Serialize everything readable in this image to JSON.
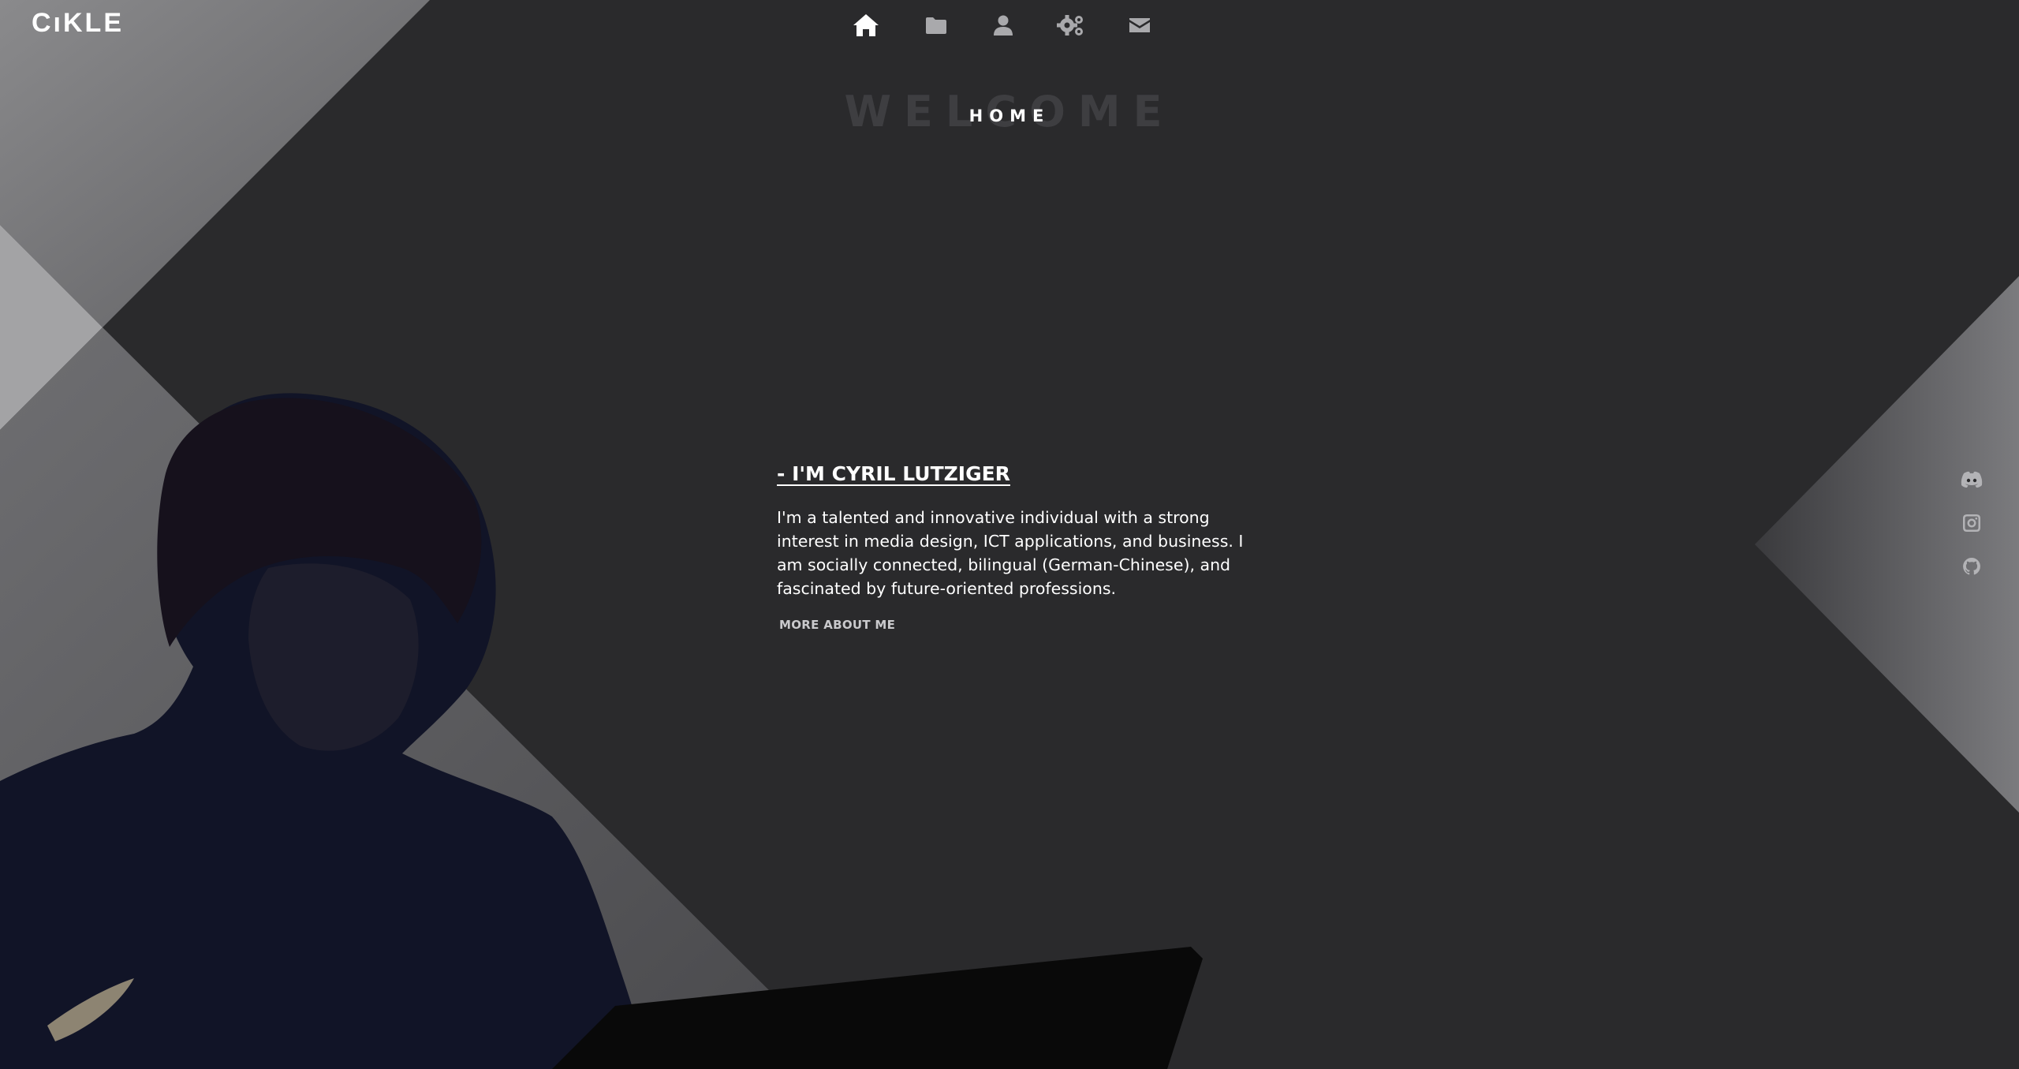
{
  "brand": {
    "logo_text": "CıKLE"
  },
  "nav": {
    "items": [
      {
        "icon": "home-icon",
        "active": true
      },
      {
        "icon": "folder-icon",
        "active": false
      },
      {
        "icon": "user-icon",
        "active": false
      },
      {
        "icon": "gears-icon",
        "active": false
      },
      {
        "icon": "envelope-icon",
        "active": false
      }
    ]
  },
  "section": {
    "ghost_word": "WELCOME",
    "title": "HOME"
  },
  "hero": {
    "heading": "- I'M CYRIL LUTZIGER",
    "text": "I'm a talented and innovative individual with a strong interest in media design, ICT applications, and business. I am socially connected, bilingual (German-Chinese), and fascinated by future-oriented professions.",
    "button_label": "MORE ABOUT ME"
  },
  "social": {
    "items": [
      {
        "icon": "discord-icon"
      },
      {
        "icon": "instagram-icon"
      },
      {
        "icon": "github-icon"
      }
    ]
  },
  "colors": {
    "background": "#2a2a2c",
    "panel_light": "#8a8a8c",
    "panel_mid": "#6b6b6e",
    "text": "#ffffff",
    "nav_icon": "#a9a9ac"
  }
}
